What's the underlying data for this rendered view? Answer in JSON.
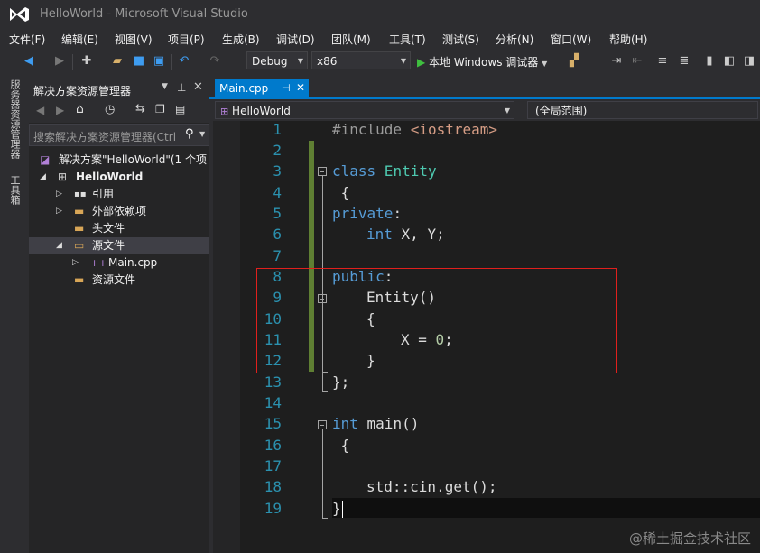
{
  "window": {
    "title": "HelloWorld - Microsoft Visual Studio"
  },
  "menu": [
    "文件(F)",
    "编辑(E)",
    "视图(V)",
    "项目(P)",
    "生成(B)",
    "调试(D)",
    "团队(M)",
    "工具(T)",
    "测试(S)",
    "分析(N)",
    "窗口(W)",
    "帮助(H)"
  ],
  "toolbar": {
    "config": "Debug",
    "platform": "x86",
    "run_label": "本地 Windows 调试器"
  },
  "left_tabs": [
    "服务器资源管理器",
    "工具箱"
  ],
  "solution_explorer": {
    "title": "解决方案资源管理器",
    "search_placeholder": "搜索解决方案资源管理器(Ctrl",
    "tree": [
      {
        "label": "解决方案\"HelloWorld\"(1 个项",
        "arrow": ""
      },
      {
        "label": "HelloWorld",
        "arrow": "◢"
      },
      {
        "label": "引用",
        "arrow": "▷"
      },
      {
        "label": "外部依赖项",
        "arrow": "▷"
      },
      {
        "label": "头文件",
        "arrow": ""
      },
      {
        "label": "源文件",
        "arrow": "◢"
      },
      {
        "label": "Main.cpp",
        "arrow": "▷"
      },
      {
        "label": "资源文件",
        "arrow": ""
      }
    ]
  },
  "editor": {
    "tab": "Main.cpp",
    "nav_left": "HelloWorld",
    "nav_right": "(全局范围)",
    "lines": [
      "1",
      "2",
      "3",
      "4",
      "5",
      "6",
      "7",
      "8",
      "9",
      "10",
      "11",
      "12",
      "13",
      "14",
      "15",
      "16",
      "17",
      "18",
      "19"
    ]
  },
  "code": {
    "l1_pp": "#include ",
    "l1_inc": "<iostream>",
    "l3_kw": "class",
    "l3_ty": " Entity",
    "l4": " {",
    "l5_kw": "private",
    "l5_c": ":",
    "l6_kw": "int",
    "l6_rest": " X, Y;",
    "l8_kw": "public",
    "l8_c": ":",
    "l9": "Entity()",
    "l10": "{",
    "l11_a": "X = ",
    "l11_num": "0",
    "l11_b": ";",
    "l12": "}",
    "l13": "};",
    "l15_kw": "int",
    "l15_rest": " main()",
    "l16": " {",
    "l18": "std::cin.get();",
    "l19": "}"
  },
  "watermark": "@稀土掘金技术社区"
}
